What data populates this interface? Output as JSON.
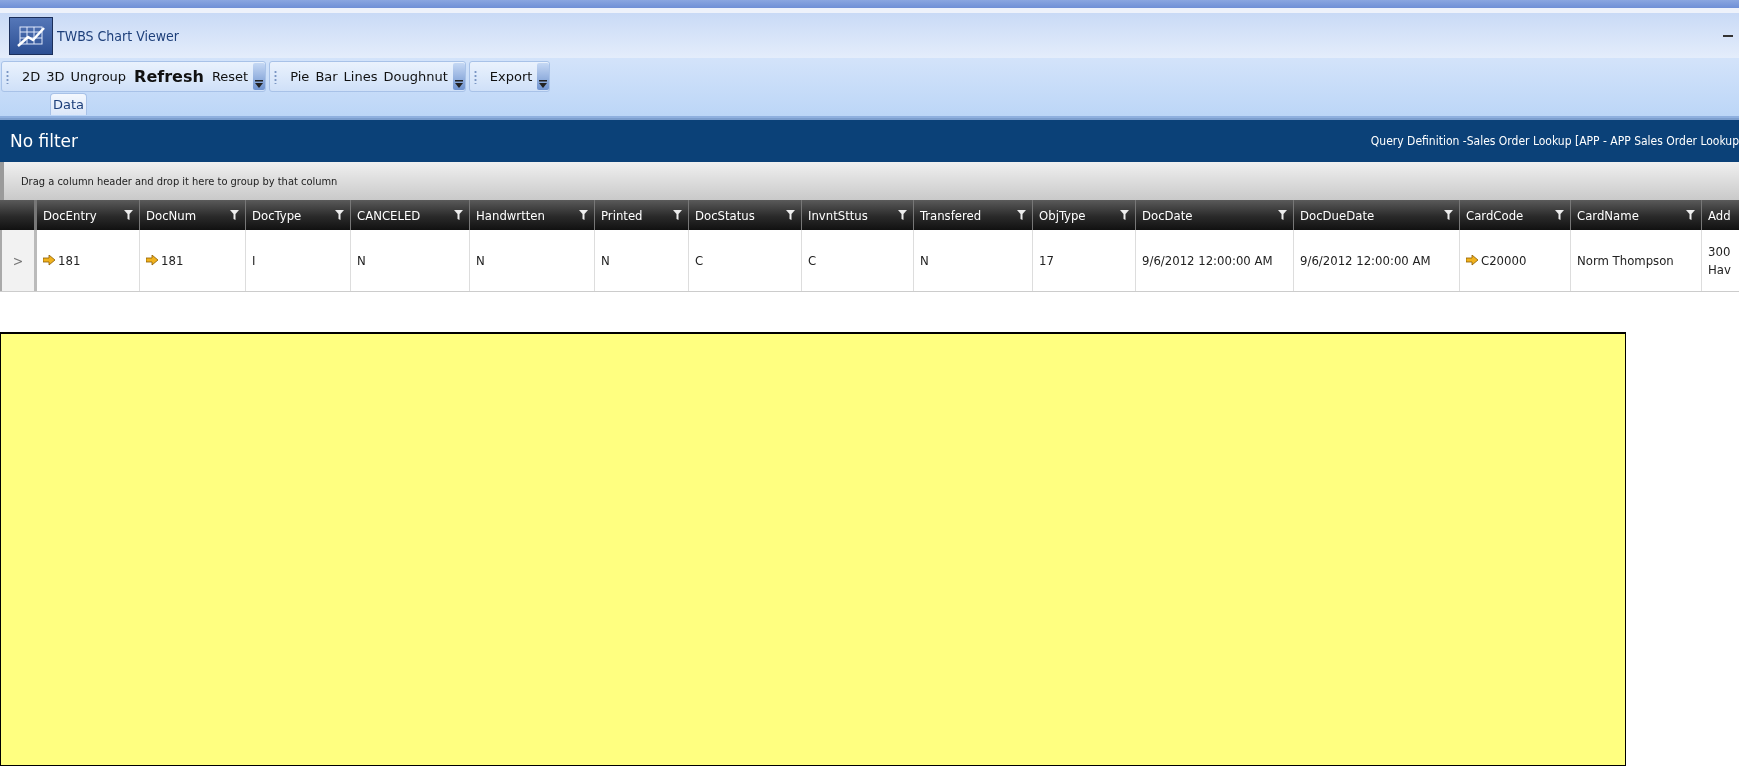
{
  "window": {
    "title": "TWBS Chart Viewer"
  },
  "toolbar": {
    "groups": [
      {
        "buttons": [
          {
            "label": "2D",
            "kind": "normal"
          },
          {
            "label": "3D",
            "kind": "normal"
          },
          {
            "label": "Ungroup",
            "kind": "normal"
          },
          {
            "label": "Refresh",
            "kind": "large"
          },
          {
            "label": "Reset",
            "kind": "normal"
          }
        ]
      },
      {
        "buttons": [
          {
            "label": "Pie",
            "kind": "normal"
          },
          {
            "label": "Bar",
            "kind": "normal"
          },
          {
            "label": "Lines",
            "kind": "normal"
          },
          {
            "label": "Doughnut",
            "kind": "normal"
          }
        ]
      },
      {
        "buttons": [
          {
            "label": "Export",
            "kind": "normal"
          }
        ]
      }
    ]
  },
  "tabs": [
    {
      "label": "Data",
      "selected": true
    }
  ],
  "header_bar": {
    "filter": "No filter",
    "query": "Query Definition -Sales Order Lookup [APP - APP Sales Order Lookup"
  },
  "group_panel": {
    "hint": "Drag a column header and drop it here to group by that column"
  },
  "table": {
    "columns": [
      "DocEntry",
      "DocNum",
      "DocType",
      "CANCELED",
      "Handwrtten",
      "Printed",
      "DocStatus",
      "InvntSttus",
      "Transfered",
      "ObjType",
      "DocDate",
      "DocDueDate",
      "CardCode",
      "CardName",
      "Add"
    ],
    "rows": [
      {
        "indicator": ">",
        "cells": [
          {
            "text": "181",
            "link": true
          },
          {
            "text": "181",
            "link": true
          },
          {
            "text": "I",
            "link": false
          },
          {
            "text": "N",
            "link": false
          },
          {
            "text": "N",
            "link": false
          },
          {
            "text": "N",
            "link": false
          },
          {
            "text": "C",
            "link": false
          },
          {
            "text": "C",
            "link": false
          },
          {
            "text": "N",
            "link": false
          },
          {
            "text": "17",
            "link": false
          },
          {
            "text": "9/6/2012 12:00:00 AM",
            "link": false
          },
          {
            "text": "9/6/2012 12:00:00 AM",
            "link": false
          },
          {
            "text": "C20000",
            "link": true
          },
          {
            "text": "Norm Thompson",
            "link": false
          },
          {
            "text": "300\nHav",
            "link": false
          }
        ]
      }
    ]
  }
}
